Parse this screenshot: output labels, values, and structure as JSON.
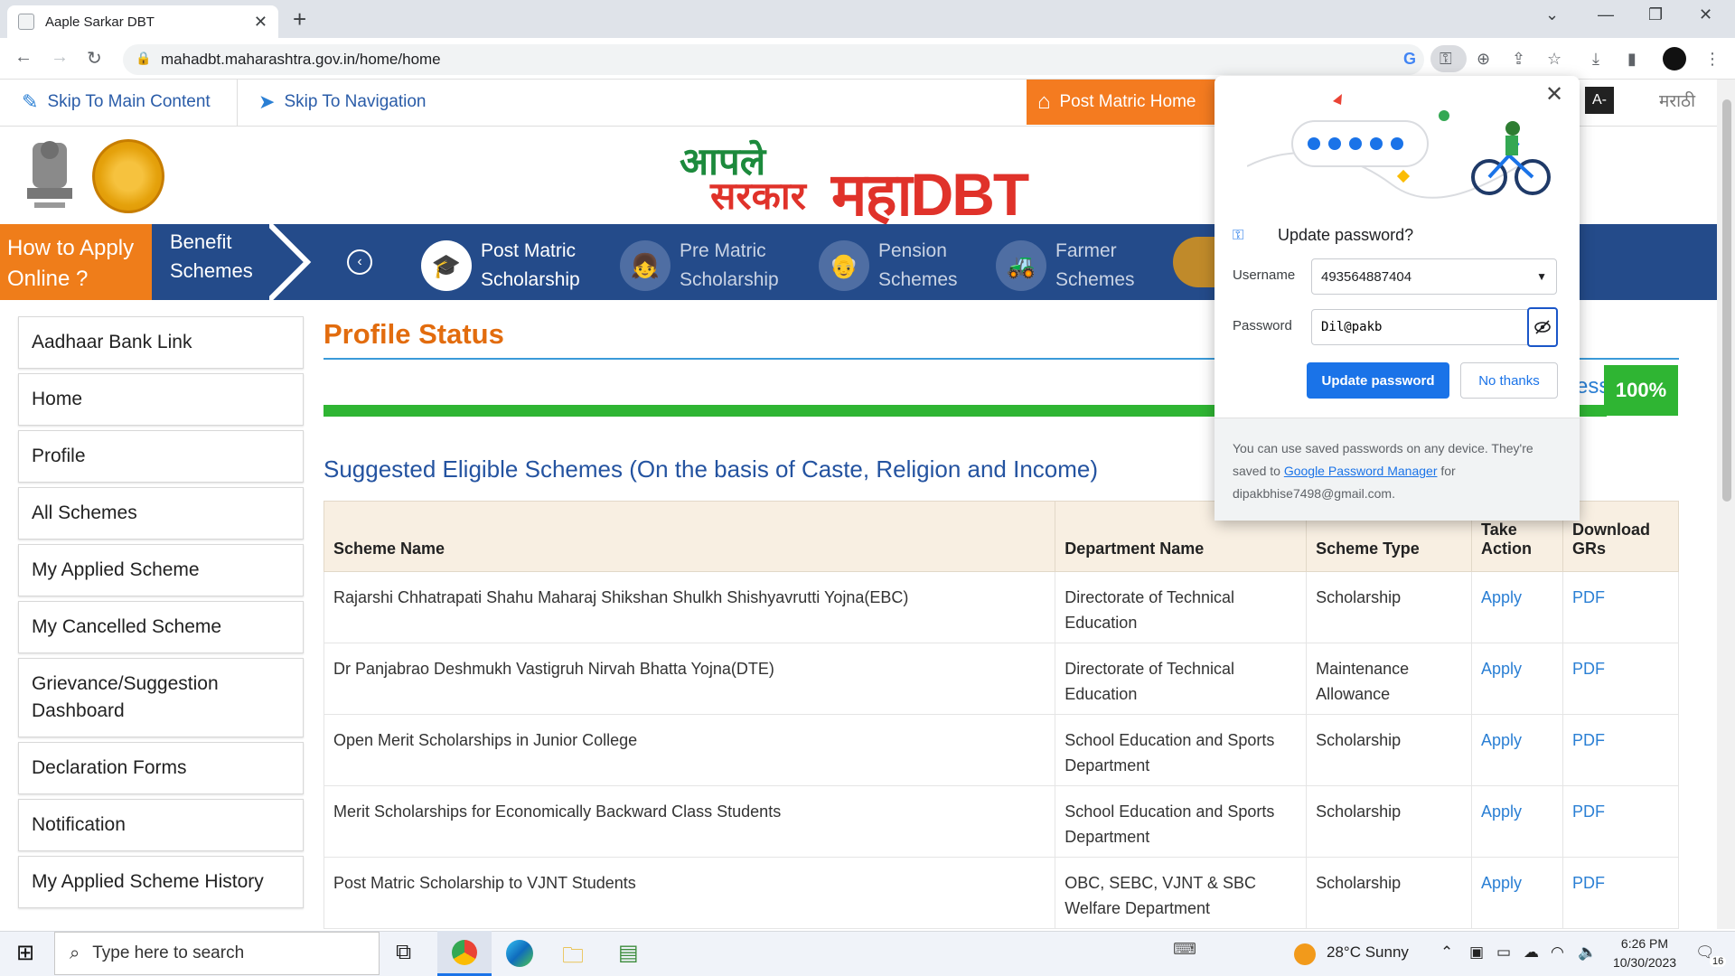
{
  "browser": {
    "tab_title": "Aaple Sarkar DBT",
    "url": "mahadbt.maharashtra.gov.in/home/home"
  },
  "topbar": {
    "skip_main": "Skip To Main Content",
    "skip_nav": "Skip To Navigation",
    "post_matric_home": "Post Matric Home",
    "font_decrease": "A-",
    "language": "मराठी"
  },
  "header": {
    "logo_text_1": "आपले",
    "logo_text_2": "सरकार",
    "maha_text": "महाDBT"
  },
  "nav": {
    "how_to": "How to Apply Online ?",
    "benefit": "Benefit Schemes",
    "items": [
      {
        "label": "Post Matric Scholarship",
        "icon": "graduation-cap-icon"
      },
      {
        "label": "Pre Matric Scholarship",
        "icon": "student-icon"
      },
      {
        "label": "Pension Schemes",
        "icon": "elder-icon"
      },
      {
        "label": "Farmer Schemes",
        "icon": "tractor-icon"
      }
    ]
  },
  "sidebar": {
    "items": [
      "Aadhaar Bank Link",
      "Home",
      "Profile",
      "All Schemes",
      "My Applied Scheme",
      "My Cancelled Scheme",
      "Grievance/Suggestion Dashboard",
      "Declaration Forms",
      "Notification",
      "My Applied Scheme History"
    ]
  },
  "main": {
    "title": "Profile Status",
    "progress_label": "100%",
    "progress_partial": "ess",
    "progress_value": 1.0,
    "suggested_heading": "Suggested Eligible Schemes (On the basis of Caste, Religion and Income)",
    "table": {
      "headers": [
        "Scheme Name",
        "Department Name",
        "Scheme Type",
        "Take Action",
        "Download GRs"
      ],
      "rows": [
        [
          "Rajarshi Chhatrapati Shahu Maharaj Shikshan Shulkh Shishyavrutti Yojna(EBC)",
          "Directorate of Technical Education",
          "Scholarship",
          "Apply",
          "PDF"
        ],
        [
          "Dr Panjabrao Deshmukh Vastigruh Nirvah Bhatta Yojna(DTE)",
          "Directorate of Technical Education",
          "Maintenance Allowance",
          "Apply",
          "PDF"
        ],
        [
          "Open Merit Scholarships in Junior College",
          "School Education and Sports Department",
          "Scholarship",
          "Apply",
          "PDF"
        ],
        [
          "Merit Scholarships for Economically Backward Class Students",
          "School Education and Sports Department",
          "Scholarship",
          "Apply",
          "PDF"
        ],
        [
          "Post Matric Scholarship to VJNT Students",
          "OBC, SEBC, VJNT & SBC Welfare Department",
          "Scholarship",
          "Apply",
          "PDF"
        ]
      ]
    }
  },
  "password_popup": {
    "title": "Update password?",
    "username_label": "Username",
    "username_value": "493564887404",
    "password_label": "Password",
    "password_value": "Dil@pakb",
    "update_button": "Update password",
    "no_button": "No thanks",
    "footer_1": "You can use saved passwords on any device. They're saved to ",
    "footer_link": "Google Password Manager",
    "footer_2": " for dipakbhise7498@gmail.com."
  },
  "taskbar": {
    "search_placeholder": "Type here to search",
    "weather": "28°C  Sunny",
    "time": "6:26 PM",
    "date": "10/30/2023",
    "notif_count": "16"
  },
  "colors": {
    "nav_blue": "#244b8a",
    "orange": "#ef7d1a",
    "progress_green": "#2fb533",
    "link_blue": "#2a7fd4",
    "chrome_blue": "#1a73e8"
  }
}
